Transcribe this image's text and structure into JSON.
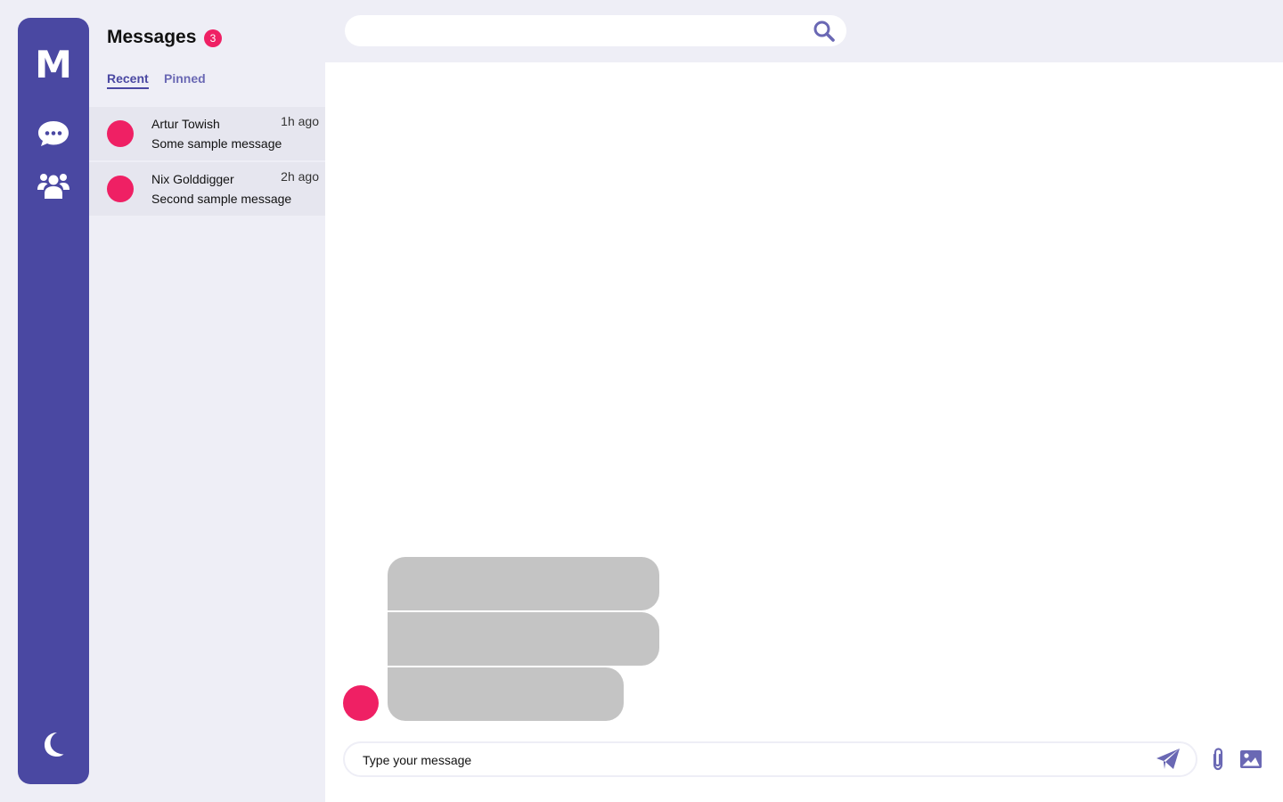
{
  "app": {
    "logo_letter": "M"
  },
  "rail": {
    "items": [
      {
        "name": "chat",
        "icon": "chat-bubble-icon"
      },
      {
        "name": "contacts",
        "icon": "users-icon"
      }
    ],
    "theme_icon": "moon-icon"
  },
  "list": {
    "title": "Messages",
    "unread_count": "3",
    "tabs": [
      {
        "label": "Recent",
        "active": true
      },
      {
        "label": "Pinned",
        "active": false
      }
    ],
    "conversations": [
      {
        "name": "Artur Towish",
        "time": "1h ago",
        "preview": "Some sample message"
      },
      {
        "name": "Nix Golddigger",
        "time": "2h ago",
        "preview": "Second sample message"
      }
    ]
  },
  "search": {
    "value": "",
    "placeholder": "",
    "icon": "search-icon"
  },
  "composer": {
    "placeholder": "Type your message",
    "send_icon": "paper-plane-icon",
    "attach_icon": "paperclip-icon",
    "image_icon": "image-icon"
  },
  "colors": {
    "primary": "#4a48a2",
    "accent": "#ef2064",
    "background": "#eeeef6",
    "bubble": "#c4c4c4"
  }
}
